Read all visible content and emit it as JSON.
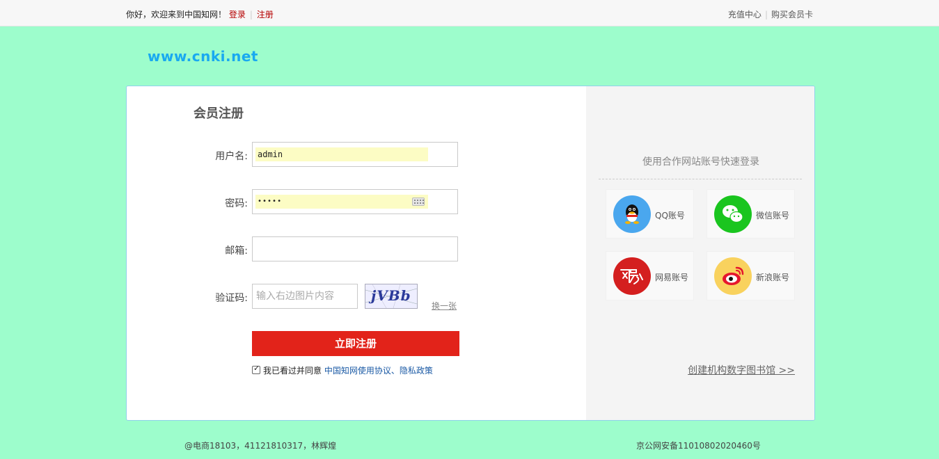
{
  "topbar": {
    "greeting": "你好，欢迎来到中国知网！",
    "login": "登录",
    "register": "注册",
    "recharge": "充值中心",
    "buy_card": "购买会员卡"
  },
  "logo": "www.cnki.net",
  "form": {
    "title": "会员注册",
    "username_label": "用户名:",
    "username_value": "admin",
    "password_label": "密码:",
    "password_value": "•••••",
    "email_label": "邮箱:",
    "email_value": "",
    "captcha_label": "验证码:",
    "captcha_placeholder": "输入右边图片内容",
    "captcha_text": "jVBb",
    "refresh_label": "换一张",
    "submit_label": "立即注册",
    "agree_prefix": "我已看过并同意",
    "agree_link": "中国知网使用协议、隐私政策",
    "agree_checked": true
  },
  "quick_login": {
    "title": "使用合作网站账号快速登录",
    "providers": [
      {
        "label": "QQ账号",
        "icon": "qq-icon",
        "color": "#4aa7ee"
      },
      {
        "label": "微信账号",
        "icon": "wechat-icon",
        "color": "#1ac51f"
      },
      {
        "label": "网易账号",
        "icon": "netease-icon",
        "color": "#d41f1f"
      },
      {
        "label": "新浪账号",
        "icon": "weibo-icon",
        "color": "#f9d25e"
      }
    ],
    "create_library": "创建机构数字图书馆 >>"
  },
  "footer": {
    "left": "@电商18103，41121810317，林辉煌",
    "right": "京公网安备11010802020460号"
  }
}
